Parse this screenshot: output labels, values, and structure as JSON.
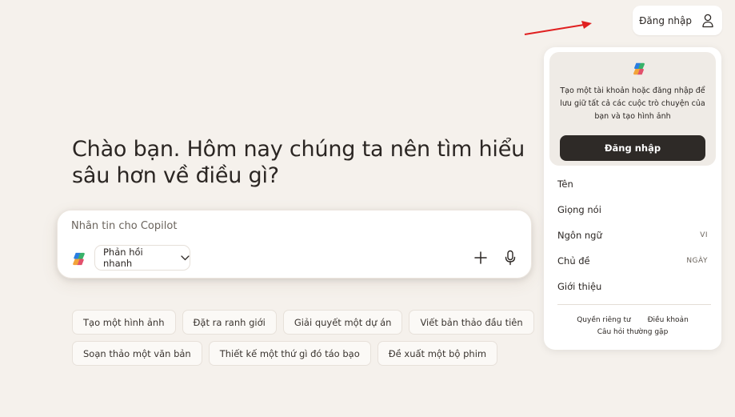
{
  "header": {
    "signin_label": "Đăng nhập"
  },
  "headline": "Chào bạn. Hôm nay chúng ta nên tìm hiểu sâu hơn về điều gì?",
  "composer": {
    "placeholder": "Nhắn tin cho Copilot",
    "mode_label": "Phản hồi nhanh"
  },
  "suggestions": {
    "row1": [
      "Tạo một hình ảnh",
      "Đặt ra ranh giới",
      "Giải quyết một dự án",
      "Viết bản thảo đầu tiên"
    ],
    "row2": [
      "Soạn thảo một văn bản",
      "Thiết kế một thứ gì đó táo bạo",
      "Đề xuất một bộ phim"
    ]
  },
  "panel": {
    "message": "Tạo một tài khoản hoặc đăng nhập để lưu giữ tất cả các cuộc trò chuyện của bạn và tạo hình ảnh",
    "signin_label": "Đăng nhập",
    "menu": [
      {
        "label": "Tên",
        "value": ""
      },
      {
        "label": "Giọng nói",
        "value": ""
      },
      {
        "label": "Ngôn ngữ",
        "value": "VI"
      },
      {
        "label": "Chủ đề",
        "value": "NGÀY"
      },
      {
        "label": "Giới thiệu",
        "value": ""
      }
    ],
    "footer": {
      "privacy": "Quyền riêng tư",
      "terms": "Điều khoản",
      "faq": "Câu hỏi thường gặp"
    }
  },
  "colors": {
    "background": "#f5f1ec",
    "primary_button": "#2e2a27",
    "annotation_arrow": "#e02020"
  }
}
